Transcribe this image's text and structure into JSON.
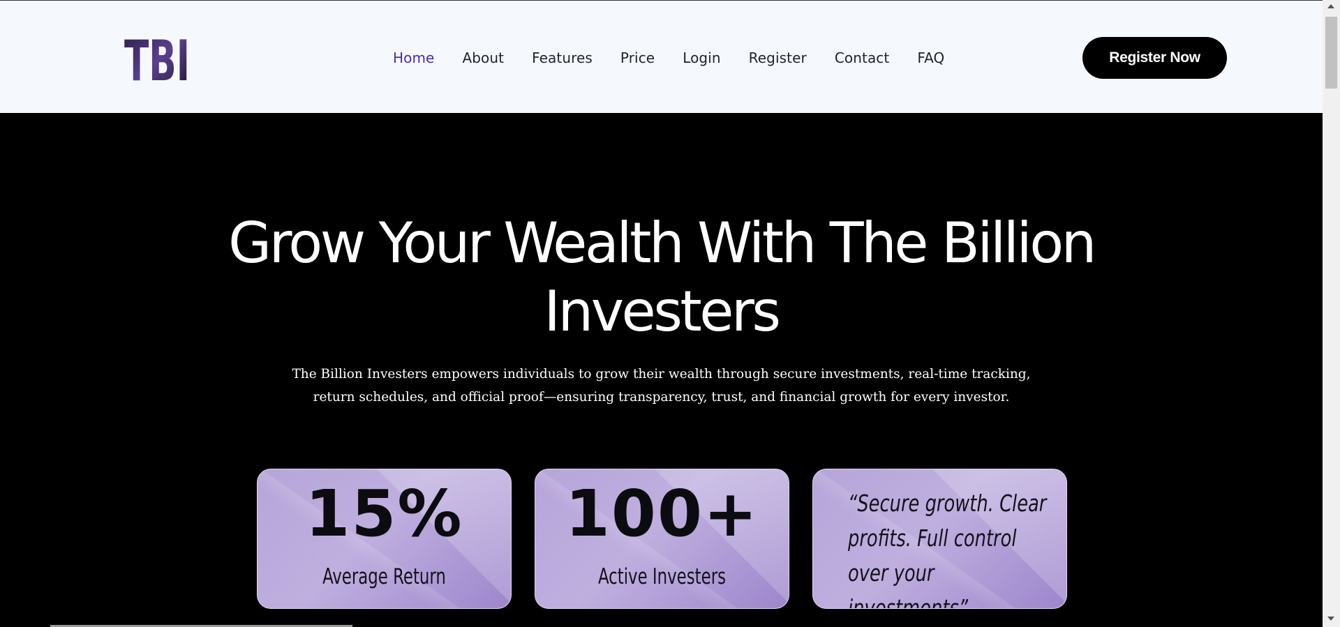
{
  "header": {
    "logo_text": "TBI",
    "nav": [
      {
        "label": "Home",
        "active": true
      },
      {
        "label": "About",
        "active": false
      },
      {
        "label": "Features",
        "active": false
      },
      {
        "label": "Price",
        "active": false
      },
      {
        "label": "Login",
        "active": false
      },
      {
        "label": "Register",
        "active": false
      },
      {
        "label": "Contact",
        "active": false
      },
      {
        "label": "FAQ",
        "active": false
      }
    ],
    "register_button": "Register Now"
  },
  "hero": {
    "title_line1": "Grow Your Wealth With The Billion",
    "title_line2": "Investers",
    "description": "The Billion Investers empowers individuals to grow their wealth through secure investments, real-time tracking, return schedules, and official proof—ensuring transparency, trust, and financial growth for every investor."
  },
  "cards": [
    {
      "value": "15%",
      "label": "Average Return"
    },
    {
      "value": "100+",
      "label": "Active Investers"
    },
    {
      "quote": "“Secure growth. Clear profits. Full control over your investments”"
    }
  ],
  "colors": {
    "accent": "#4f2ab5",
    "header_bg": "#f5f9fd",
    "card_purple": "#b6a5d9",
    "page_bg": "#000000"
  }
}
